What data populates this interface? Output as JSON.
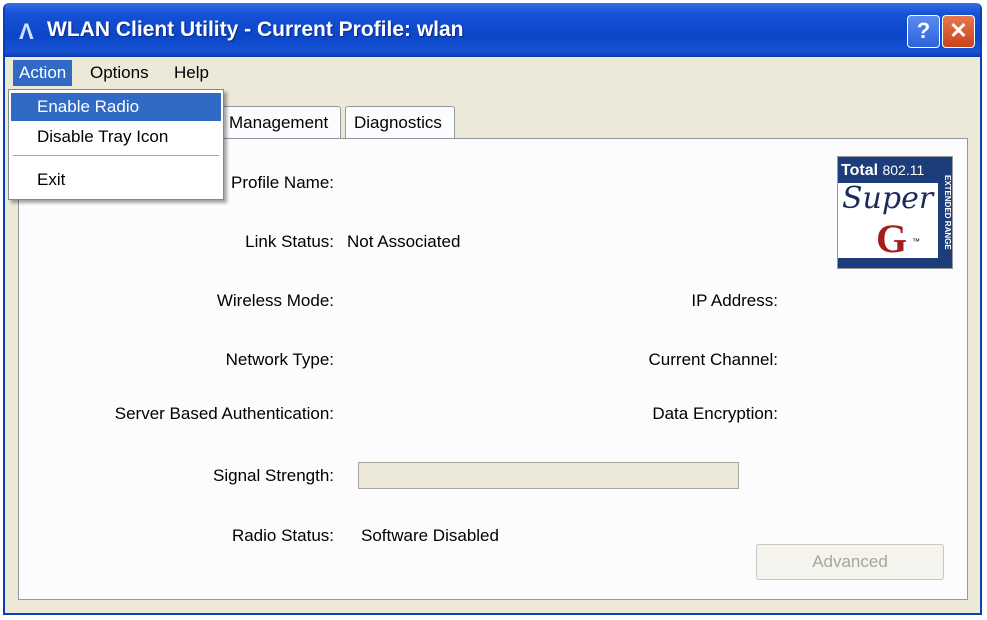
{
  "window": {
    "title": "WLAN Client Utility - Current Profile: wlan"
  },
  "menubar": {
    "action": "Action",
    "options": "Options",
    "help": "Help"
  },
  "action_menu": {
    "enable_radio": "Enable Radio",
    "disable_tray_icon": "Disable Tray Icon",
    "exit": "Exit"
  },
  "tabs": {
    "management": "Management",
    "diagnostics": "Diagnostics"
  },
  "status": {
    "profile_name_label": "Profile Name:",
    "link_status_label": "Link Status:",
    "link_status_value": "Not Associated",
    "wireless_mode_label": "Wireless Mode:",
    "ip_address_label": "IP Address:",
    "network_type_label": "Network Type:",
    "current_channel_label": "Current Channel:",
    "server_auth_label": "Server Based Authentication:",
    "data_encryption_label": "Data Encryption:",
    "signal_strength_label": "Signal Strength:",
    "signal_strength_level": 0,
    "radio_status_label": "Radio Status:",
    "radio_status_value": "Software Disabled"
  },
  "buttons": {
    "advanced": "Advanced"
  },
  "logo": {
    "total": "Total",
    "standard": "802.11",
    "super": "Super",
    "g": "G",
    "tm": "™",
    "extended": "EXTENDED RANGE"
  },
  "colors": {
    "title_bar": "#0c46c8",
    "menu_highlight": "#316ac5",
    "window_bg": "#ece9d8"
  }
}
